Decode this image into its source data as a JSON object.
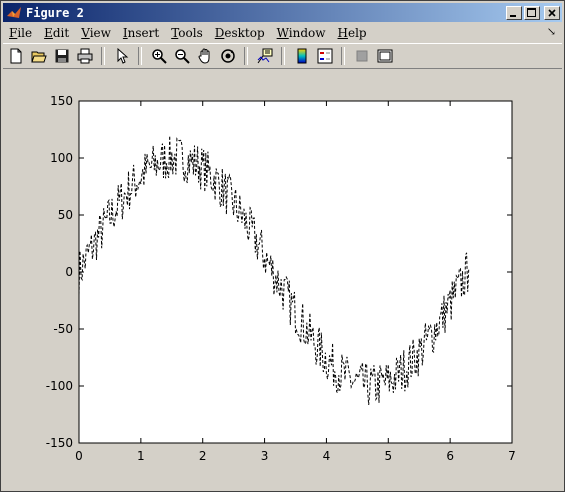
{
  "window": {
    "title": "Figure 2"
  },
  "menu": {
    "items": [
      "File",
      "Edit",
      "View",
      "Insert",
      "Tools",
      "Desktop",
      "Window",
      "Help"
    ],
    "underline": [
      "F",
      "E",
      "V",
      "I",
      "T",
      "D",
      "W",
      "H"
    ]
  },
  "toolbar": {
    "icons": [
      "new-figure-icon",
      "open-file-icon",
      "save-icon",
      "print-icon",
      "edit-plot-arrow-icon",
      "zoom-in-icon",
      "zoom-out-icon",
      "pan-hand-icon",
      "rotate-3d-icon",
      "data-cursor-icon",
      "colorbar-icon",
      "legend-icon",
      "hide-plot-tools-icon",
      "show-plot-tools-icon"
    ]
  },
  "chart_data": {
    "type": "line",
    "title": "",
    "xlabel": "",
    "ylabel": "",
    "xlim": [
      0,
      7
    ],
    "ylim": [
      -150,
      150
    ],
    "xticks": [
      0,
      1,
      2,
      3,
      4,
      5,
      6,
      7
    ],
    "yticks": [
      150,
      100,
      50,
      0,
      -50,
      -100,
      -150
    ],
    "grid": false,
    "line_style": "dashed",
    "line_color": "#000000",
    "series": [
      {
        "x": [
          0.0,
          0.1,
          0.2,
          0.3,
          0.4,
          0.5,
          0.6,
          0.7,
          0.8,
          0.9,
          1.0,
          1.1,
          1.2,
          1.3,
          1.4,
          1.5,
          1.6,
          1.7,
          1.8,
          1.9,
          2.0,
          2.1,
          2.2,
          2.3,
          2.4,
          2.5,
          2.6,
          2.7,
          2.8,
          2.9,
          3.0,
          3.1,
          3.2,
          3.3,
          3.4,
          3.5,
          3.6,
          3.7,
          3.8,
          3.9,
          4.0,
          4.1,
          4.2,
          4.3,
          4.4,
          4.5,
          4.6,
          4.7,
          4.8,
          4.9,
          5.0,
          5.1,
          5.2,
          5.3,
          5.4,
          5.5,
          5.6,
          5.7,
          5.8,
          5.9,
          6.0,
          6.1,
          6.2,
          6.3
        ],
        "y": [
          0,
          10,
          20,
          30,
          39,
          48,
          56,
          64,
          72,
          78,
          84,
          89,
          93,
          96,
          99,
          100,
          100,
          99,
          97,
          95,
          91,
          86,
          81,
          75,
          68,
          60,
          52,
          43,
          34,
          24,
          14,
          4,
          -6,
          -16,
          -26,
          -35,
          -44,
          -53,
          -61,
          -69,
          -76,
          -82,
          -87,
          -92,
          -95,
          -98,
          -99,
          -100,
          -100,
          -98,
          -96,
          -93,
          -88,
          -83,
          -77,
          -71,
          -63,
          -55,
          -46,
          -37,
          -28,
          -18,
          -8,
          2
        ]
      }
    ]
  }
}
